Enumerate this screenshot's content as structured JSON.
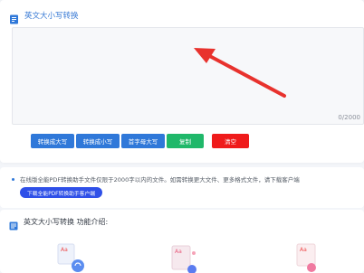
{
  "tool": {
    "title": "英文大小写转换",
    "counter": "0/2000"
  },
  "buttons": {
    "to_upper": "转换成大写",
    "to_lower": "转换成小写",
    "capitalize": "首字母大写",
    "copy": "复制",
    "clear": "清空"
  },
  "notice": {
    "text": "在线版全能PDF转换助手文件仅限于2000字以内的文件。如需转换更大文件、更多格式文件，请下载客户端",
    "download_button": "下载全能PDF转换助手客户端"
  },
  "intro": {
    "title": "英文大小写转换 功能介绍:"
  },
  "colors": {
    "accent": "#2f78d9",
    "copy": "#20b86a",
    "clear": "#ef1b1b",
    "arrow": "#e8322d",
    "download": "#2f50e8"
  }
}
